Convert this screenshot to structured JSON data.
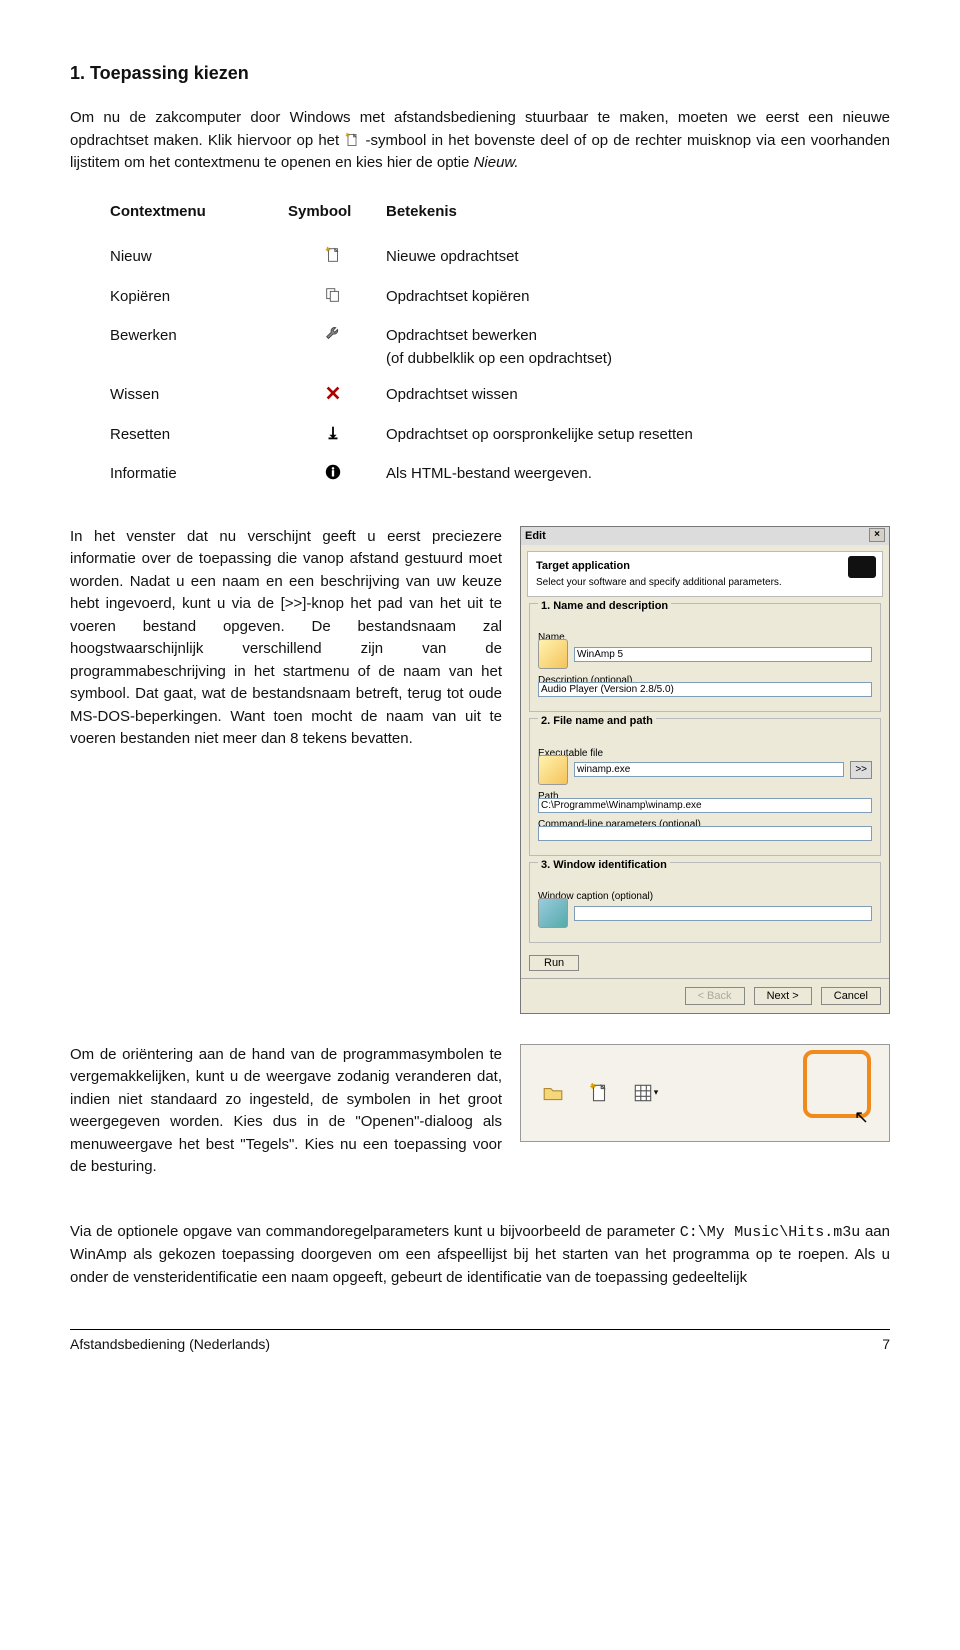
{
  "heading": "1. Toepassing kiezen",
  "intro_p1": "Om nu de zakcomputer door Windows met afstandsbediening stuurbaar te maken, moeten we eerst een nieuwe opdrachtset maken. Klik hiervoor op het ",
  "intro_p1_after": "-symbool in het bovenste deel of op de rechter muisknop via een voorhanden lijstitem om het contextmenu te openen en kies hier de optie ",
  "intro_p1_opt": "Nieuw.",
  "table": {
    "headers": {
      "menu": "Contextmenu",
      "sym": "Symbool",
      "bet": "Betekenis"
    },
    "rows": [
      {
        "menu": "Nieuw",
        "bet": "Nieuwe opdrachtset"
      },
      {
        "menu": "Kopiëren",
        "bet": "Opdrachtset kopiëren"
      },
      {
        "menu": "Bewerken",
        "bet": "Opdrachtset bewerken\n(of dubbelklik op een opdrachtset)"
      },
      {
        "menu": "Wissen",
        "bet": "Opdrachtset wissen"
      },
      {
        "menu": "Resetten",
        "bet": "Opdrachtset op oorspronkelijke setup resetten"
      },
      {
        "menu": "Informatie",
        "bet": "Als HTML-bestand weergeven."
      }
    ]
  },
  "para2": "In het venster dat nu verschijnt geeft u eerst preciezere informatie over de toepassing die vanop afstand gestuurd moet worden. Nadat u een naam en een beschrijving van uw keuze hebt ingevoerd, kunt u via de [>>]-knop het pad van het uit te voeren bestand opgeven. De bestandsnaam zal hoogstwaarschijnlijk verschillend zijn van de programmabeschrijving in het startmenu of de naam van het symbool. Dat gaat, wat de bestandsnaam betreft, terug tot oude MS-DOS-beperkingen. Want toen mocht de naam van uit te voeren bestanden niet meer dan 8 tekens bevatten.",
  "dialog": {
    "title": "Edit",
    "target_title": "Target application",
    "target_sub": "Select your software and specify additional parameters.",
    "section1": "1. Name and description",
    "lbl_name": "Name",
    "val_name": "WinAmp 5",
    "lbl_desc": "Description (optional)",
    "val_desc": "Audio Player (Version 2.8/5.0)",
    "section2": "2. File name and path",
    "lbl_exe": "Executable file",
    "val_exe": "winamp.exe",
    "lbl_path": "Path",
    "val_path": "C:\\Programme\\Winamp\\winamp.exe",
    "lbl_cmd": "Command-line parameters (optional)",
    "section3": "3. Window identification",
    "lbl_caption": "Window caption (optional)",
    "btn_run": "Run",
    "btn_back": "< Back",
    "btn_next": "Next >",
    "btn_cancel": "Cancel",
    "btn_browse": ">>"
  },
  "para3": "Om de oriëntering aan de hand van de programmasymbolen te vergemakkelijken, kunt u de weergave zodanig veranderen dat, indien niet standaard zo ingesteld, de symbolen in het groot weergegeven worden. Kies dus in de \"Openen\"-dialoog als menuweergave het best \"Tegels\". Kies nu een toepassing voor de besturing.",
  "para4_a": "Via de optionele opgave van commandoregelparameters kunt u bijvoorbeeld de parameter ",
  "para4_code": "C:\\My Music\\Hits.m3u",
  "para4_b": " aan WinAmp als gekozen toepassing doorgeven om een afspeellijst bij het starten van het programma op te roepen. Als u onder de vensteridentificatie een naam opgeeft, gebeurt de identificatie van de toepassing gedeeltelijk",
  "footer": {
    "left": "Afstandsbediening (Nederlands)",
    "right": "7"
  }
}
